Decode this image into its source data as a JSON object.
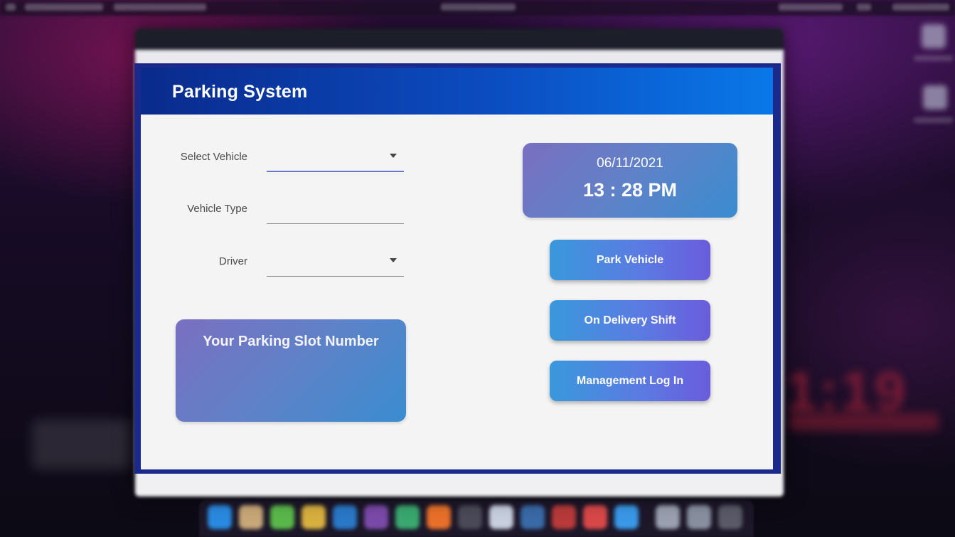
{
  "app": {
    "title": "Parking System"
  },
  "form": {
    "select_vehicle": {
      "label": "Select Vehicle",
      "value": ""
    },
    "vehicle_type": {
      "label": "Vehicle Type",
      "value": ""
    },
    "driver": {
      "label": "Driver",
      "value": ""
    }
  },
  "slot": {
    "title": "Your Parking Slot Number",
    "value": ""
  },
  "clock": {
    "date": "06/11/2021",
    "time": "13 : 28 PM"
  },
  "actions": {
    "park_vehicle": "Park Vehicle",
    "on_delivery_shift": "On Delivery Shift",
    "management_log_in": "Management Log In"
  },
  "icons": {
    "dropdown": "chevron-down-icon"
  },
  "colors": {
    "header_start": "#0a2a8c",
    "header_end": "#0a78e8",
    "card_gradient_start": "#7a6fc0",
    "card_gradient_end": "#3a8cd0",
    "button_gradient_start": "#3a98dc",
    "button_gradient_end": "#6a5cdc",
    "content_background": "#f4f4f4"
  }
}
